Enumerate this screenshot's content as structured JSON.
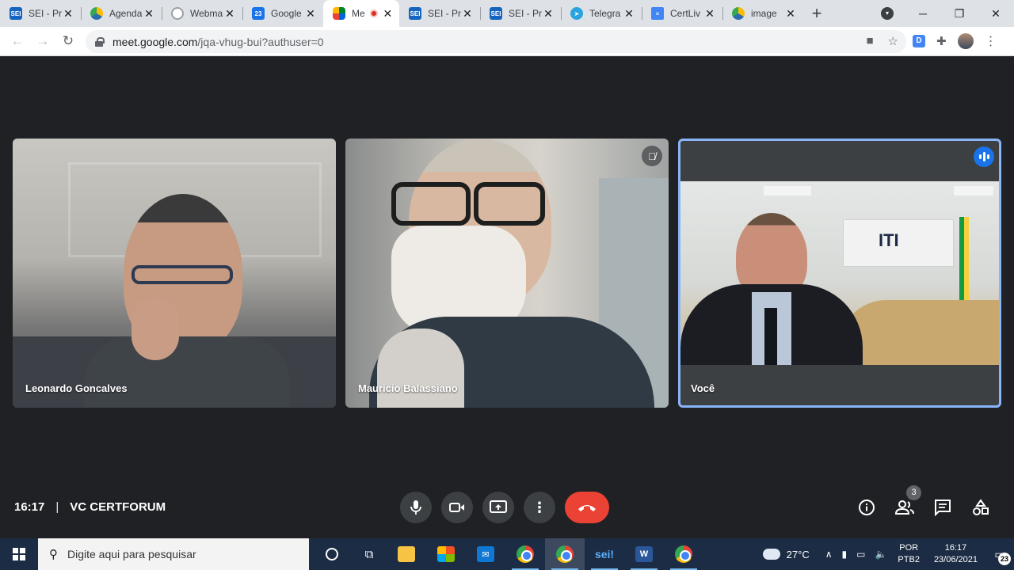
{
  "browser": {
    "tabs": [
      {
        "title": "SEI - Pr",
        "favicon": "SEI",
        "color": "#1565c0"
      },
      {
        "title": "Agenda",
        "favicon": "",
        "color": "#2b6cb0"
      },
      {
        "title": "Webma",
        "favicon": "",
        "color": "#9aa0a6"
      },
      {
        "title": "Google",
        "favicon": "23",
        "color": "#1a73e8"
      },
      {
        "title": "Me",
        "favicon": "",
        "color": "#00832d"
      },
      {
        "title": "SEI - Pr",
        "favicon": "SEI",
        "color": "#1565c0"
      },
      {
        "title": "SEI - Pr",
        "favicon": "SEI",
        "color": "#1565c0"
      },
      {
        "title": "Telegra",
        "favicon": "",
        "color": "#2aa3df"
      },
      {
        "title": "CertLiv",
        "favicon": "",
        "color": "#4285f4"
      },
      {
        "title": "image",
        "favicon": "",
        "color": "#2b6cb0"
      }
    ],
    "active_tab_index": 4,
    "new_tab_label": "+",
    "url_host": "meet.google.com",
    "url_path": "/jqa-vhug-bui?authuser=0",
    "extension_letter": "D"
  },
  "meet": {
    "participants": [
      {
        "name": "Leonardo Goncalves",
        "muted": false,
        "speaking": false
      },
      {
        "name": "Mauricio Balassiano",
        "muted": true,
        "speaking": false
      },
      {
        "name": "Você",
        "muted": false,
        "speaking": true
      }
    ],
    "room_sign_text": "ITI",
    "time": "16:17",
    "meeting_name": "VC CERTFORUM",
    "separator": "|",
    "participants_count": "3",
    "colors": {
      "end_call": "#ea4335",
      "speaking_border": "#8ab4f8",
      "background": "#202124"
    }
  },
  "taskbar": {
    "search_placeholder": "Digite aqui para pesquisar",
    "weather_temp": "27°C",
    "language": "POR",
    "keyboard": "PTB2",
    "clock_time": "16:17",
    "clock_date": "23/06/2021",
    "notifications": "23",
    "sei_label": "sei!",
    "word_label": "W"
  }
}
